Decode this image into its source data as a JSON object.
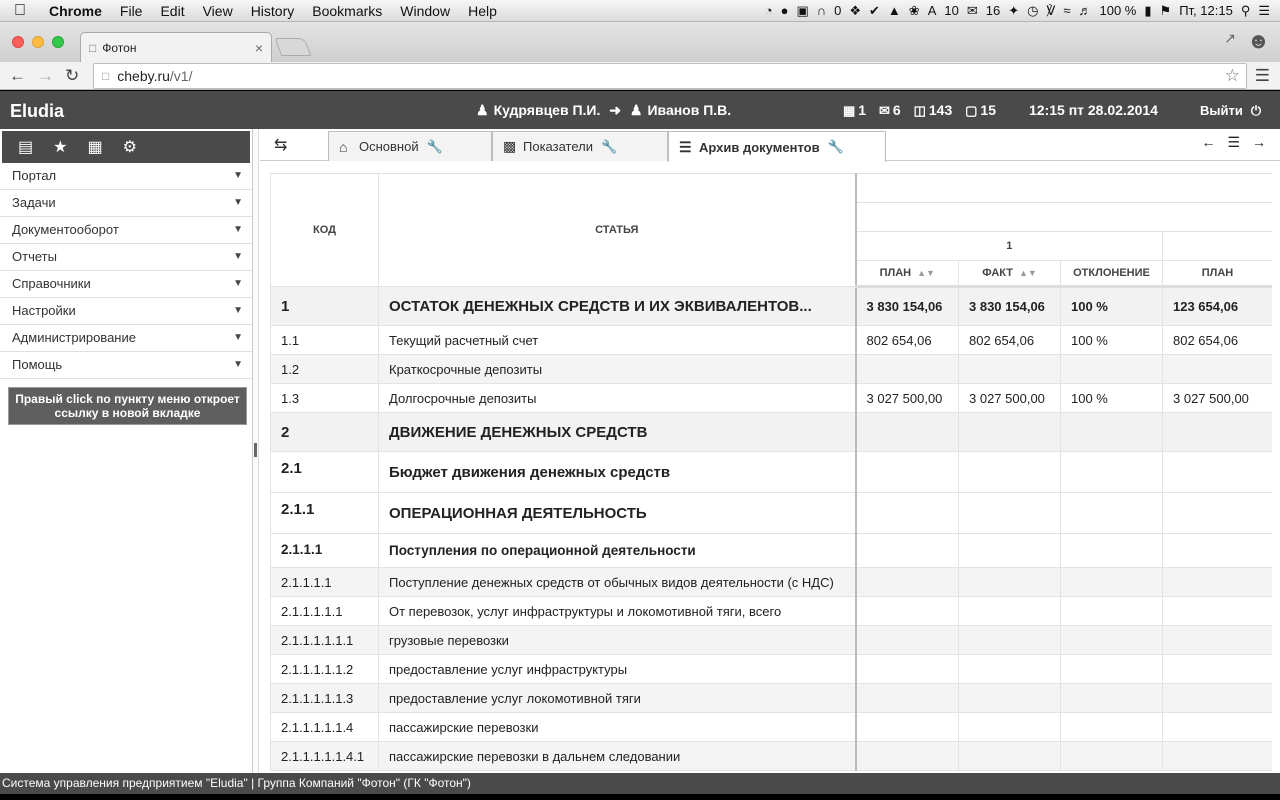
{
  "menubar": {
    "app_name": "Chrome",
    "items": [
      "File",
      "Edit",
      "View",
      "History",
      "Bookmarks",
      "Window",
      "Help"
    ],
    "tray_count_a": "0",
    "tray_count_b": "10",
    "tray_count_c": "16",
    "battery": "100 %",
    "clock": "Пт, 12:15"
  },
  "browser": {
    "tab_title": "Фотон",
    "url_host": "cheby.ru",
    "url_path": "/v1/"
  },
  "header": {
    "logo": "Eludia",
    "user_from": "Кудрявцев П.И.",
    "user_to": "Иванов П.В.",
    "count_tasks": "1",
    "count_mail": "6",
    "count_inbox": "143",
    "count_docs": "15",
    "datetime": "12:15 пт 28.02.2014",
    "logout": "Выйти"
  },
  "sidebar": {
    "items": [
      "Портал",
      "Задачи",
      "Документооборот",
      "Отчеты",
      "Справочники",
      "Настройки",
      "Администрирование",
      "Помощь"
    ],
    "hint": "Правый click по пункту меню откроет ссылку в новой вкладке"
  },
  "tabs": [
    {
      "label": "Основной"
    },
    {
      "label": "Показатели"
    },
    {
      "label": "Архив документов"
    }
  ],
  "table": {
    "headers": {
      "code": "КОД",
      "name": "СТАТЬЯ",
      "group": "1",
      "plan": "ПЛАН",
      "fact": "ФАКТ",
      "deviation": "ОТКЛОНЕНИЕ",
      "plan2": "ПЛАН"
    },
    "rows": [
      {
        "code": "1",
        "name": "ОСТАТОК ДЕНЕЖНЫХ СРЕДСТВ И ИХ ЭКВИВАЛЕНТОВ...",
        "plan": "3 830 154,06",
        "fact": "3 830 154,06",
        "dev": "100 %",
        "plan2": "123 654,06"
      },
      {
        "code": "1.1",
        "name": "Текущий расчетный счет",
        "plan": "802 654,06",
        "fact": "802 654,06",
        "dev": "100 %",
        "plan2": "802 654,06"
      },
      {
        "code": "1.2",
        "name": "Краткосрочные депозиты",
        "plan": "",
        "fact": "",
        "dev": "",
        "plan2": ""
      },
      {
        "code": "1.3",
        "name": "Долгосрочные депозиты",
        "plan": "3 027 500,00",
        "fact": "3 027 500,00",
        "dev": "100 %",
        "plan2": "3 027 500,00"
      },
      {
        "code": "2",
        "name": "ДВИЖЕНИЕ ДЕНЕЖНЫХ СРЕДСТВ",
        "plan": "",
        "fact": "",
        "dev": "",
        "plan2": ""
      },
      {
        "code": "2.1",
        "name": "Бюджет движения денежных средств",
        "plan": "",
        "fact": "",
        "dev": "",
        "plan2": ""
      },
      {
        "code": "2.1.1",
        "name": "ОПЕРАЦИОННАЯ ДЕЯТЕЛЬНОСТЬ",
        "plan": "",
        "fact": "",
        "dev": "",
        "plan2": ""
      },
      {
        "code": "2.1.1.1",
        "name": "Поступления по операционной деятельности",
        "plan": "",
        "fact": "",
        "dev": "",
        "plan2": ""
      },
      {
        "code": "2.1.1.1.1",
        "name": "Поступление денежных средств от обычных видов деятельности (с НДС)",
        "plan": "",
        "fact": "",
        "dev": "",
        "plan2": ""
      },
      {
        "code": "2.1.1.1.1.1",
        "name": "От перевозок, услуг инфраструктуры и локомотивной тяги, всего",
        "plan": "",
        "fact": "",
        "dev": "",
        "plan2": ""
      },
      {
        "code": "2.1.1.1.1.1.1",
        "name": "грузовые перевозки",
        "plan": "",
        "fact": "",
        "dev": "",
        "plan2": ""
      },
      {
        "code": "2.1.1.1.1.1.2",
        "name": "предоставление услуг инфраструктуры",
        "plan": "",
        "fact": "",
        "dev": "",
        "plan2": ""
      },
      {
        "code": "2.1.1.1.1.1.3",
        "name": "предоставление услуг локомотивной тяги",
        "plan": "",
        "fact": "",
        "dev": "",
        "plan2": ""
      },
      {
        "code": "2.1.1.1.1.1.4",
        "name": "пассажирские перевозки",
        "plan": "",
        "fact": "",
        "dev": "",
        "plan2": ""
      },
      {
        "code": "2.1.1.1.1.1.4.1",
        "name": "пассажирские перевозки в дальнем следовании",
        "plan": "",
        "fact": "",
        "dev": "",
        "plan2": ""
      }
    ]
  },
  "footer": {
    "text": "Система управления предприятием \"Eludia\" | Группа Компаний \"Фотон\" (ГК \"Фотон\")"
  }
}
